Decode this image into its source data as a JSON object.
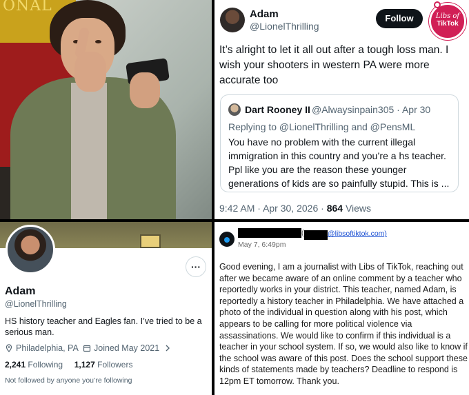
{
  "photo": {
    "flag_text": "ONAL"
  },
  "tweet": {
    "author_name": "Adam",
    "author_handle": "@LionelThrilling",
    "follow_label": "Follow",
    "text": "It’s alright to let it all out after a tough loss man. I wish your shooters in western PA were more accurate too",
    "logo": {
      "line1": "Libs of",
      "line2": "TikTok",
      "color": "#d11f56"
    },
    "quoted": {
      "author_name": "Dart Rooney II",
      "author_handle": "@Alwaysinpain305",
      "separator": "·",
      "date": "Apr 30",
      "replying_to": "Replying to @LionelThrilling and @PensML",
      "text": "You have no problem with the current illegal immigration in this country and you’re a hs teacher. Ppl like you are the reason these younger generations of kids are so painfully stupid. This is ..."
    },
    "time": "9:42 AM",
    "date": "Apr 30, 2026",
    "views_count": "864",
    "views_label": "Views"
  },
  "profile": {
    "more_label": "···",
    "name": "Adam",
    "handle": "@LionelThrilling",
    "bio": "HS history teacher and Eagles fan. I’ve tried to be a serious man.",
    "location": "Philadelphia, PA",
    "joined": "Joined May 2021",
    "following_count": "2,241",
    "following_label": "Following",
    "followers_count": "1,127",
    "followers_label": "Followers",
    "not_followed": "Not followed by anyone you’re following"
  },
  "email": {
    "paren_open": "(",
    "address": "@libsoftiktok.com)",
    "date": "May 7, 6:49pm",
    "body": "Good evening, I am a journalist with Libs of TikTok, reaching out after we became aware of an online comment by a teacher who reportedly works in your district. This teacher, named Adam, is reportedly a history teacher in Philadelphia. We have attached a photo of the individual in question along with his post, which appears to be calling for more political violence via assassinations. We would like to confirm if this individual is a teacher in your school system. If so, we would also like to know if the school was aware of this post. Does the school support these kinds of statements made by teachers? Deadline to respond is 12pm ET tomorrow. Thank you."
  }
}
